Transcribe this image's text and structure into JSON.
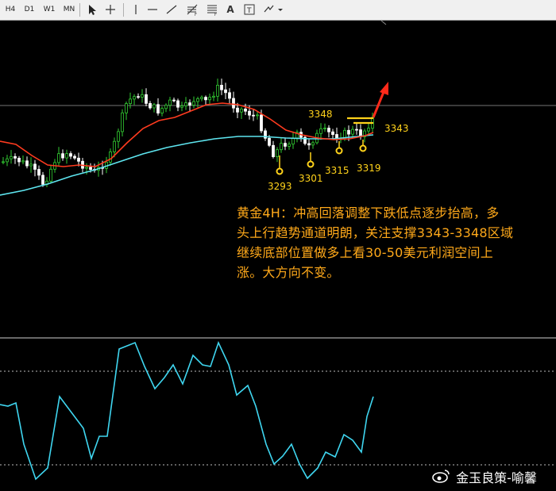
{
  "toolbar": {
    "timeframes": [
      "H4",
      "D1",
      "W1",
      "MN"
    ],
    "tools": [
      "cursor-icon",
      "crosshair-icon",
      "vertical-line-icon",
      "horizontal-line-icon",
      "trendline-icon",
      "fibonacci-icon",
      "text-icon",
      "text-label-icon",
      "arrows-dropdown-icon"
    ]
  },
  "chart": {
    "levels": [
      {
        "label": "3348",
        "color": "#ffd21a"
      },
      {
        "label": "3343",
        "color": "#ffd21a"
      }
    ],
    "lows": [
      {
        "label": "3293"
      },
      {
        "label": "3301"
      },
      {
        "label": "3315"
      },
      {
        "label": "3319"
      }
    ],
    "colors": {
      "background": "#000000",
      "bull_candle": "#32cd32",
      "bear_candle": "#ffffff",
      "ma_fast": "#ff3b1f",
      "ma_slow": "#5ee6f0",
      "oscillator": "#3fd6f0",
      "annotation": "#ffa91a",
      "arrow": "#ff2a1a"
    }
  },
  "annotation": {
    "lines": [
      "黄金4H：冲高回落调整下跌低点逐步抬高，多",
      "头上行趋势通道明朗，关注支撑3343-3348区域",
      "继续底部位置做多上看30-50美元利润空间上",
      "涨。大方向不变。"
    ]
  },
  "watermark": {
    "logo": "weibo-logo-icon",
    "text": "金玉良策-喻馨"
  }
}
